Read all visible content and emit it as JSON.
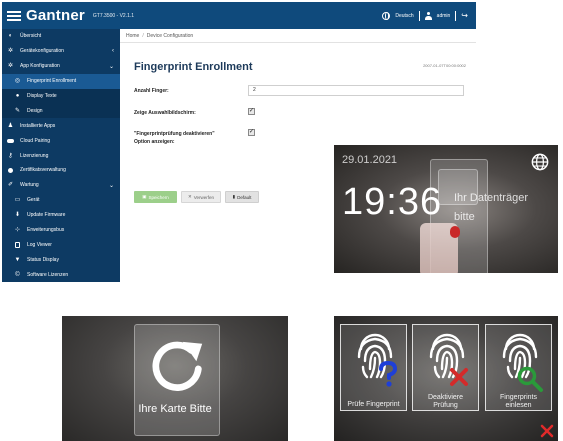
{
  "admin": {
    "topbar": {
      "brand": "Gantner",
      "version": "GT7.3500 - V2.1.1",
      "language": "Deutsch",
      "user": "admin"
    },
    "sidebar": {
      "items": [
        {
          "label": "Übersicht",
          "icon": "dashboard-icon"
        },
        {
          "label": "Gerätekonfiguration",
          "icon": "gear-icon",
          "chevron": "‹"
        },
        {
          "label": "App Konfiguration",
          "icon": "gears-icon",
          "chevron": "⌄"
        },
        {
          "label": "Fingerprint Enrollment",
          "icon": "fingerprint-icon"
        },
        {
          "label": "Display Texte",
          "icon": "display-icon"
        },
        {
          "label": "Design",
          "icon": "brush-icon"
        },
        {
          "label": "Installierte Apps",
          "icon": "apps-icon"
        },
        {
          "label": "Cloud Pairing",
          "icon": "cloud-icon"
        },
        {
          "label": "Lizenzierung",
          "icon": "key-icon"
        },
        {
          "label": "Zertifikatsverwaltung",
          "icon": "certificate-icon"
        },
        {
          "label": "Wartung",
          "icon": "wrench-icon",
          "chevron": "⌄"
        },
        {
          "label": "Gerät",
          "icon": "monitor-icon"
        },
        {
          "label": "Update Firmware",
          "icon": "download-icon"
        },
        {
          "label": "Erweiterungsbus",
          "icon": "sitemap-icon"
        },
        {
          "label": "Log Viewer",
          "icon": "file-icon"
        },
        {
          "label": "Status Display",
          "icon": "funnel-icon"
        },
        {
          "label": "Software Lizenzen",
          "icon": "copyright-icon"
        }
      ]
    },
    "breadcrumb": {
      "home": "Home",
      "sep": "/",
      "current": "Device Configuration"
    },
    "page": {
      "title": "Fingerprint Enrollment",
      "device_id": "2007-01-07T00:00:0002",
      "fields": {
        "finger_count_label": "Anzahl Finger:",
        "finger_count_value": "2",
        "show_selection_label": "Zeige Auswahlbildschirm:",
        "show_selection_checked": true,
        "disable_check_label_1": "\"Fingerprintprüfung deaktivieren\"",
        "disable_check_label_2": "Option anzeigen:",
        "disable_check_checked": true
      },
      "buttons": {
        "save": "Speichern",
        "discard": "Verwerfen",
        "default": "Default"
      }
    }
  },
  "terminal_clock": {
    "date": "29.01.2021",
    "time": "19:36",
    "message": "Ihr Datenträger bitte",
    "message_line1": "Ihr Datenträger",
    "message_line2": "bitte"
  },
  "terminal_card": {
    "message": "Ihre Karte Bitte"
  },
  "terminal_fingerprint": {
    "tiles": [
      {
        "line1": "Prüfe Fingerprint",
        "line2": "",
        "badge_color": "#1e3fd8"
      },
      {
        "line1": "Deaktiviere",
        "line2": "Prüfung",
        "badge_color": "#d42a2a"
      },
      {
        "line1": "Fingerprints",
        "line2": "einlesen",
        "badge_color": "#2a9a3a"
      }
    ],
    "close_color": "#e02a2a"
  },
  "colors": {
    "topbar": "#0f4a7c",
    "sidebar": "#0d3a63",
    "sidebar_active": "#1a5a94",
    "title": "#1d3a5a",
    "save_button": "#9ccf8a"
  }
}
